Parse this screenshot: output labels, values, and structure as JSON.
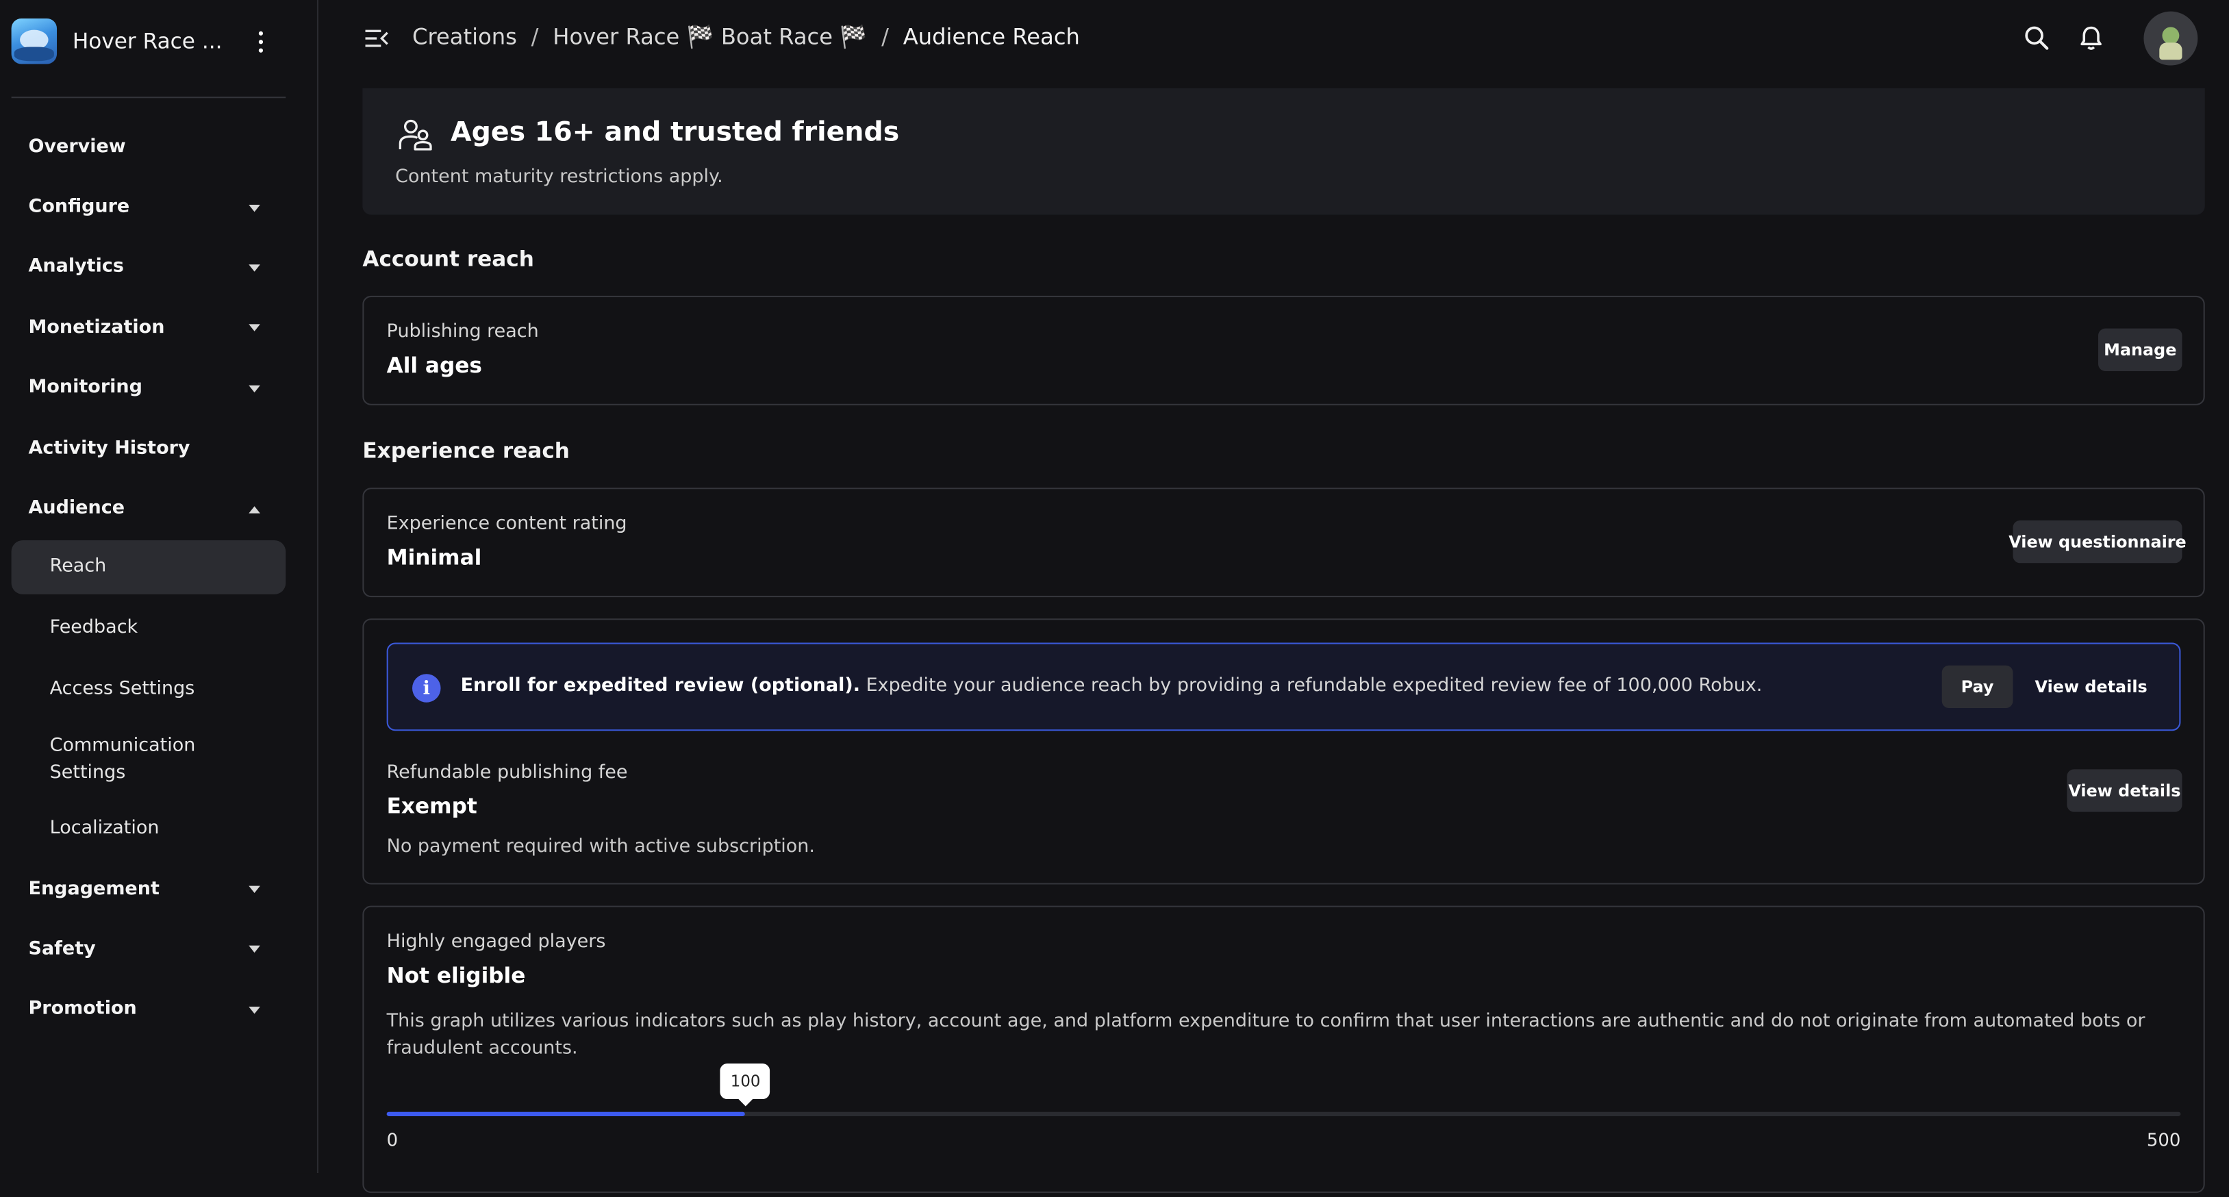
{
  "app": {
    "name": "Hover Race ..."
  },
  "sidebar": {
    "items": [
      {
        "label": "Overview"
      },
      {
        "label": "Configure"
      },
      {
        "label": "Analytics"
      },
      {
        "label": "Monetization"
      },
      {
        "label": "Monitoring"
      },
      {
        "label": "Activity History"
      },
      {
        "label": "Audience"
      },
      {
        "label": "Engagement"
      },
      {
        "label": "Safety"
      },
      {
        "label": "Promotion"
      }
    ],
    "audience_sub": [
      {
        "label": "Reach"
      },
      {
        "label": "Feedback"
      },
      {
        "label": "Access Settings"
      },
      {
        "label": "Communication Settings"
      },
      {
        "label": "Localization"
      }
    ]
  },
  "breadcrumb": {
    "root": "Creations",
    "separator": "/",
    "experience": "Hover Race 🏁 Boat Race 🏁",
    "current": "Audience Reach"
  },
  "banner": {
    "title": "Ages 16+ and trusted friends",
    "subtitle": "Content maturity restrictions apply."
  },
  "account_reach": {
    "section_title": "Account reach",
    "label": "Publishing reach",
    "value": "All ages",
    "button": "Manage"
  },
  "experience_reach": {
    "section_title": "Experience reach",
    "rating_label": "Experience content rating",
    "rating_value": "Minimal",
    "rating_button": "View questionnaire",
    "notice_bold": "Enroll for expedited review (optional).",
    "notice_text": " Expedite your audience reach by providing a refundable expedited review fee of 100,000 Robux.",
    "pay_button": "Pay",
    "notice_details_button": "View details",
    "fee_label": "Refundable publishing fee",
    "fee_value": "Exempt",
    "fee_desc": "No payment required with active subscription.",
    "fee_details_button": "View details"
  },
  "engagement": {
    "label": "Highly engaged players",
    "value": "Not eligible",
    "desc": "This graph utilizes various indicators such as play history, account age, and platform expenditure to confirm that user interactions are authentic and do not originate from automated bots or fraudulent accounts.",
    "slider": {
      "value": 100,
      "min": 0,
      "max": 500,
      "value_label": "100",
      "min_label": "0",
      "max_label": "500"
    }
  },
  "colors": {
    "accent": "#3d5bf0",
    "background": "#121215",
    "card_border": "#34353b"
  },
  "icons": [
    "menu-collapse-icon",
    "search-icon",
    "bell-icon",
    "people-icon",
    "info-icon",
    "kebab-icon",
    "chevron-down-icon",
    "chevron-up-icon"
  ]
}
